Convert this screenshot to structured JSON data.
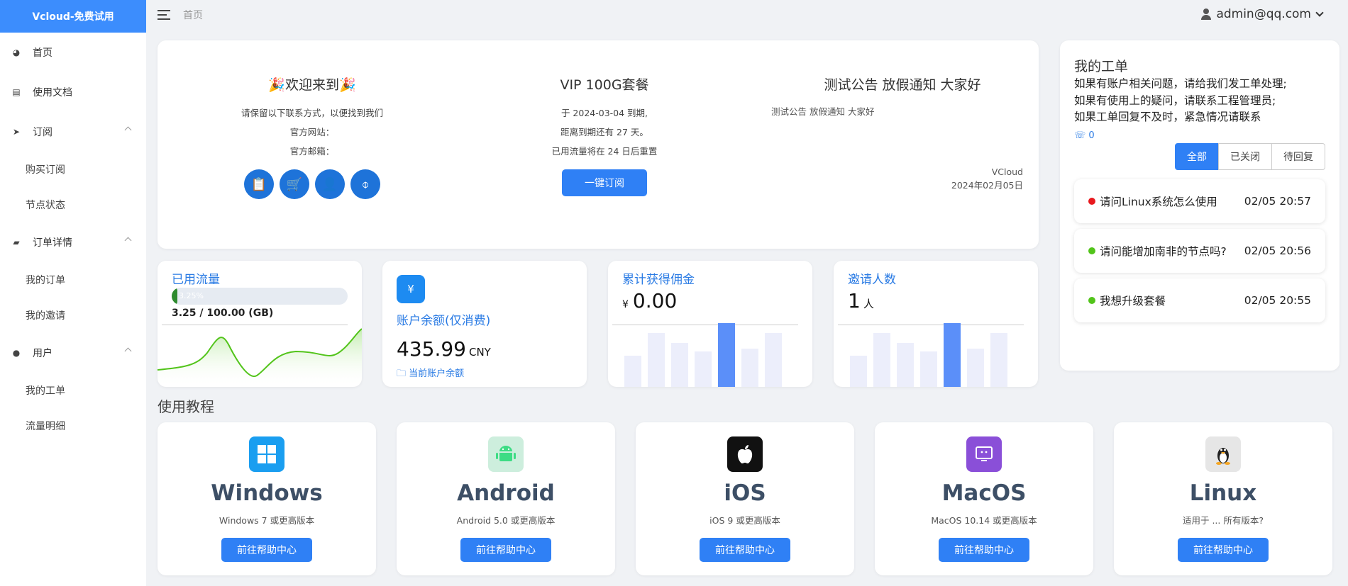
{
  "sidebar": {
    "brand": "Vcloud-免费试用",
    "items": [
      {
        "label": "首页"
      },
      {
        "label": "使用文档"
      },
      {
        "label": "订阅"
      },
      {
        "label": "购买订阅"
      },
      {
        "label": "节点状态"
      },
      {
        "label": "订单详情"
      },
      {
        "label": "我的订单"
      },
      {
        "label": "我的邀请"
      },
      {
        "label": "用户"
      },
      {
        "label": "我的工单"
      },
      {
        "label": "流量明细"
      }
    ]
  },
  "header": {
    "breadcrumb": "首页",
    "user": "admin@qq.com"
  },
  "welcome": {
    "title": "🎉欢迎来到🎉",
    "line1": "请保留以下联系方式，以便找到我们",
    "website": "官方网站：",
    "email": "官方邮箱："
  },
  "plan": {
    "title": "VIP 100G套餐",
    "expire": "于 2024-03-04 到期,",
    "remain": "距离到期还有 27 天。",
    "reset": "已用流量将在 24 日后重置",
    "button": "一键订阅"
  },
  "notice": {
    "title": "测试公告 放假通知 大家好",
    "body": "测试公告 放假通知 大家好",
    "author": "VCloud",
    "date": "2024年02月05日"
  },
  "traffic": {
    "label": "已用流量",
    "percent_text": "3.25%",
    "percent": 3.25,
    "value": "3.25 / 100.00 (GB)"
  },
  "balance": {
    "label": "账户余额(仅消费)",
    "value": "435.99",
    "unit": "CNY",
    "link": "当前账户余额"
  },
  "commission": {
    "label": "累计获得佣金",
    "currency": "¥",
    "value": "0.00"
  },
  "invites": {
    "label": "邀请人数",
    "value": "1",
    "unit": "人"
  },
  "tickets": {
    "title": "我的工单",
    "desc1": "如果有账户相关问题，请给我们发工单处理;",
    "desc2": "如果有使用上的疑问，请联系工程管理员;",
    "desc3": "如果工单回复不及时，紧急情况请联系",
    "phone_count": "0",
    "tabs": [
      "全部",
      "已关闭",
      "待回复"
    ],
    "rows": [
      {
        "title": "请问Linux系统怎么使用",
        "time": "02/05 20:57",
        "status_color": "#e8191e"
      },
      {
        "title": "请问能增加南非的节点吗?",
        "time": "02/05 20:56",
        "status_color": "#52c41a"
      },
      {
        "title": "我想升级套餐",
        "time": "02/05 20:55",
        "status_color": "#52c41a"
      }
    ]
  },
  "tutorial": {
    "title": "使用教程",
    "button": "前往帮助中心",
    "items": [
      {
        "name": "Windows",
        "ver": "Windows 7 或更高版本",
        "icon": "windows-icon"
      },
      {
        "name": "Android",
        "ver": "Android 5.0 或更高版本",
        "icon": "android-icon"
      },
      {
        "name": "iOS",
        "ver": "iOS 9 或更高版本",
        "icon": "apple-icon"
      },
      {
        "name": "MacOS",
        "ver": "MacOS 10.14 或更高版本",
        "icon": "macos-icon"
      },
      {
        "name": "Linux",
        "ver": "适用于 ... 所有版本?",
        "icon": "linux-icon"
      }
    ]
  },
  "colors": {
    "primary": "#2f80f5",
    "brand": "#3c8dfd",
    "bar_light": "#eceefb",
    "bar_highlight": "#5b8ff9",
    "traffic_line": "#52c41a"
  }
}
